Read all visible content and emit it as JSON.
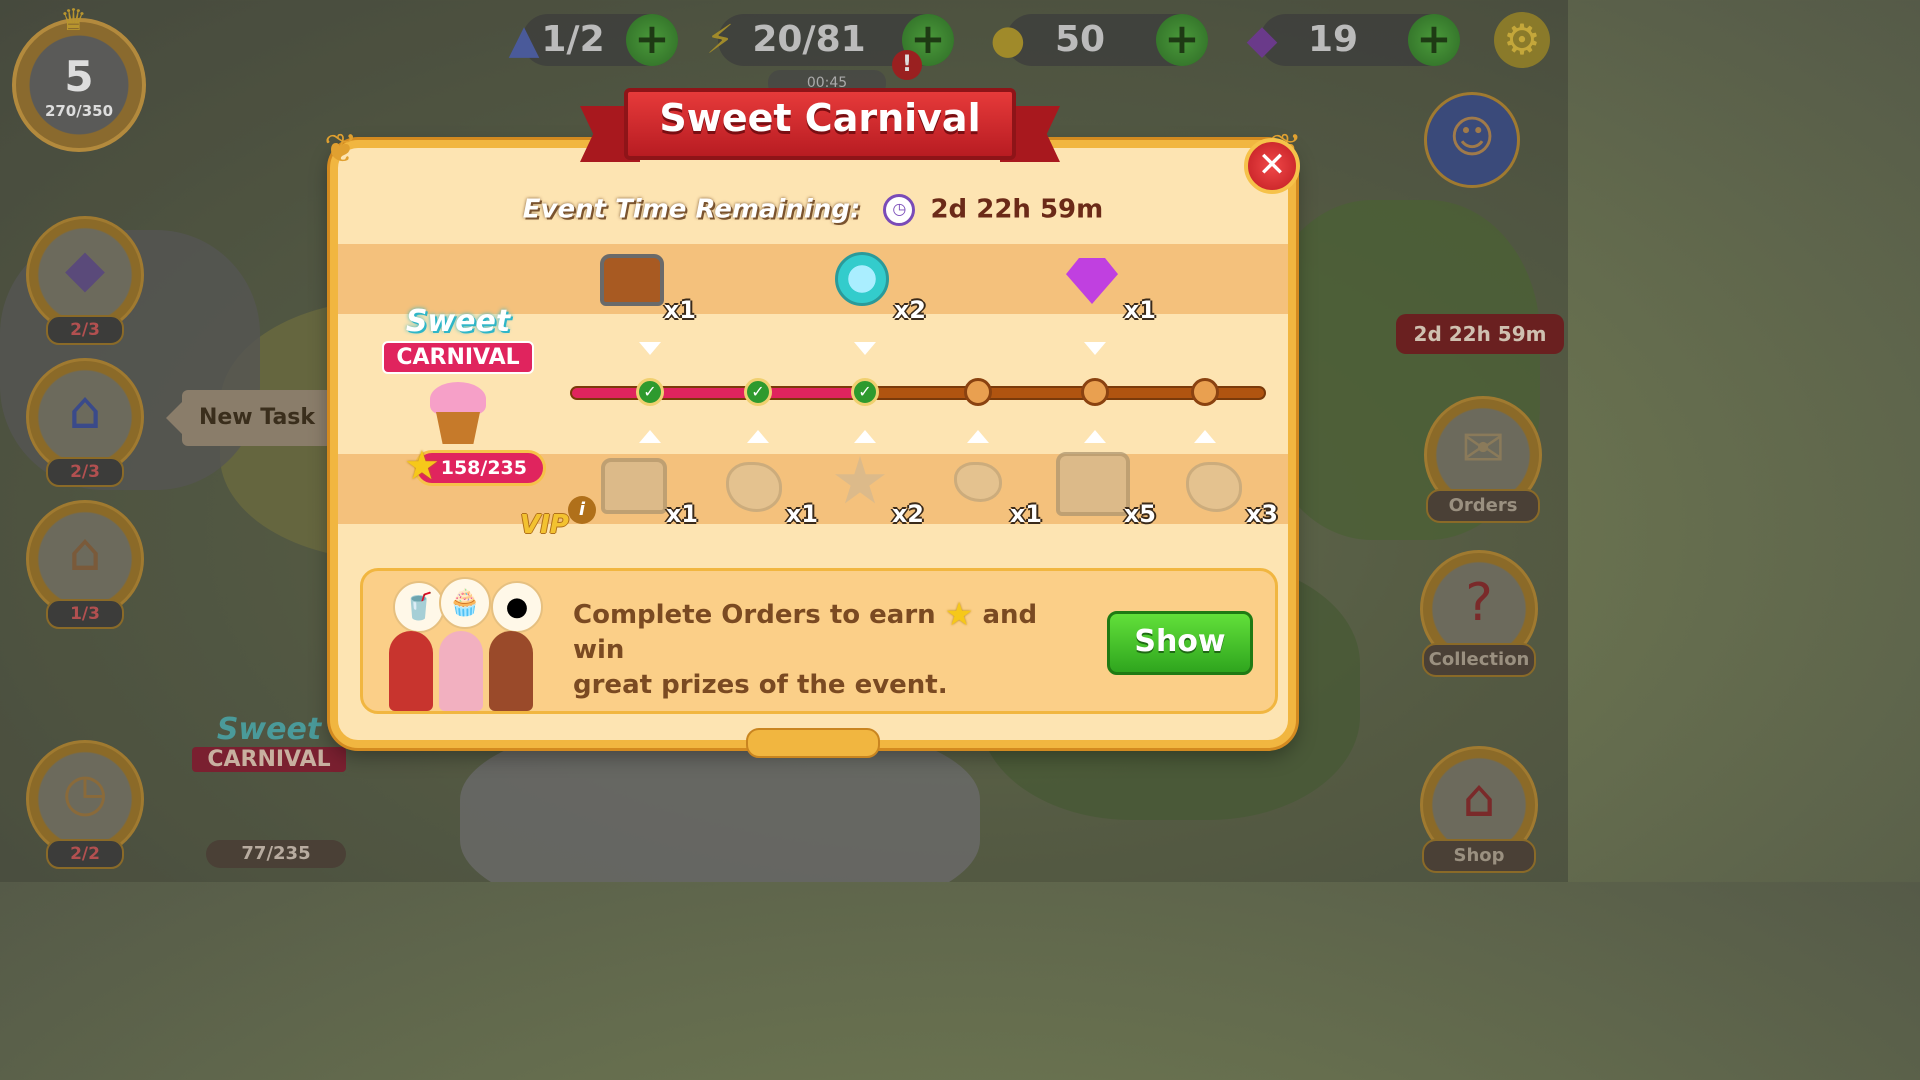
{
  "hud": {
    "level": "5",
    "xp": "270/350",
    "wizards": "1/2",
    "energy": "20/81",
    "energy_timer": "00:45",
    "coins": "50",
    "gems": "19",
    "alert_mark": "!"
  },
  "sidebar_left": {
    "counters": [
      "2/3",
      "2/3",
      "1/3",
      "2/2"
    ],
    "new_task_label": "New Task",
    "event_mini": {
      "sweet": "Sweet",
      "carnival": "CARNIVAL",
      "progress": "77/235"
    }
  },
  "sidebar_right": {
    "event_timer": "2d 22h 59m",
    "orders_label": "Orders",
    "collection_label": "Collection",
    "shop_label": "Shop"
  },
  "modal": {
    "title": "Sweet Carnival",
    "time_label": "Event Time Remaining:",
    "time_value": "2d 22h 59m",
    "logo_sweet": "Sweet",
    "logo_carnival": "CARNIVAL",
    "progress": "158/235",
    "progress_fraction": 0.672,
    "milestones_completed": 3,
    "milestones_total": 6,
    "top_rewards": [
      {
        "icon": "chest-icon",
        "qty": "x1"
      },
      {
        "icon": "teal-coin-icon",
        "qty": "x2"
      },
      {
        "icon": "purple-gem-icon",
        "qty": "x1"
      }
    ],
    "vip_label": "VIP",
    "info_mark": "i",
    "vip_rewards": [
      {
        "icon": "chest-icon",
        "qty": "x1"
      },
      {
        "icon": "rock-icon",
        "qty": "x1"
      },
      {
        "icon": "star-wand-icon",
        "qty": "x2"
      },
      {
        "icon": "stones-icon",
        "qty": "x1"
      },
      {
        "icon": "big-chest-icon",
        "qty": "x5"
      },
      {
        "icon": "rock-icon",
        "qty": "x3"
      }
    ],
    "info_line1_a": "Complete Orders to earn",
    "info_line1_b": "and win",
    "info_line2": "great prizes of the event.",
    "show_label": "Show",
    "close_label": "✕"
  },
  "colors": {
    "ribbon": "#d32a2e",
    "panel": "#fde4b2",
    "progress_fill": "#e0245e",
    "show_button": "#3fbf26"
  }
}
